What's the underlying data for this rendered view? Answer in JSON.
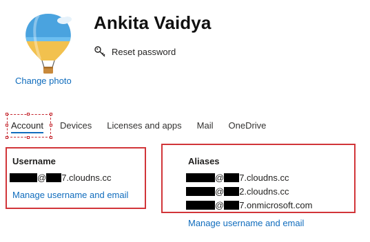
{
  "profile": {
    "name": "Ankita Vaidya",
    "change_photo_label": "Change photo",
    "reset_password_label": "Reset password"
  },
  "tabs": [
    {
      "label": "Account",
      "active": true
    },
    {
      "label": "Devices",
      "active": false
    },
    {
      "label": "Licenses and apps",
      "active": false
    },
    {
      "label": "Mail",
      "active": false
    },
    {
      "label": "OneDrive",
      "active": false
    }
  ],
  "username_section": {
    "title": "Username",
    "value_visible_part_1": "@",
    "value_visible_part_2": "7.cloudns.cc",
    "manage_link": "Manage username and email"
  },
  "aliases_section": {
    "title": "Aliases",
    "aliases": [
      {
        "visible_part_1": "@",
        "visible_part_2": "7.cloudns.cc"
      },
      {
        "visible_part_1": "@",
        "visible_part_2": "2.cloudns.cc"
      },
      {
        "visible_part_1": "@",
        "visible_part_2": "7.onmicrosoft.com"
      }
    ],
    "manage_link": "Manage username and email"
  },
  "colors": {
    "link": "#0f6cbd",
    "highlight_border": "#d13438",
    "text": "#201f1e"
  },
  "icons": {
    "avatar": "hot-air-balloon-avatar",
    "reset_password": "key-icon"
  }
}
